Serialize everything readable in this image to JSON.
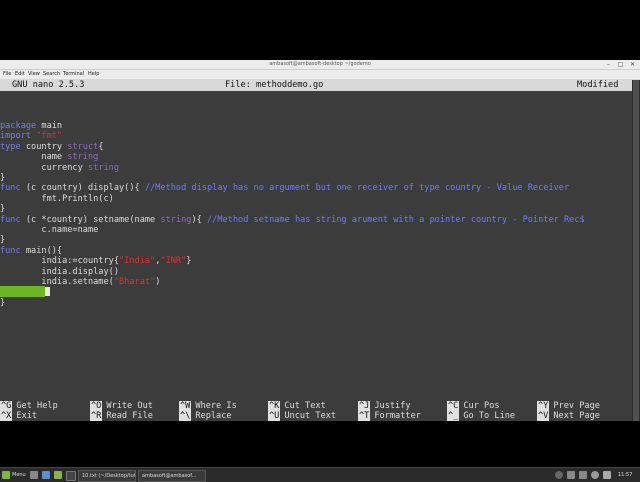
{
  "window": {
    "title": "ambasoft@ambasoft-desktop ~/godemo"
  },
  "menubar": [
    "File",
    "Edit",
    "View",
    "Search",
    "Terminal",
    "Help"
  ],
  "nano": {
    "version": "GNU nano 2.5.3",
    "file": "File: methoddemo.go",
    "status": "Modified"
  },
  "code": [
    [
      [
        "kw",
        "package"
      ],
      [
        "id",
        " main"
      ]
    ],
    [
      [
        "kw",
        "import"
      ],
      [
        "id",
        " "
      ],
      [
        "st",
        "\"fmt\""
      ]
    ],
    [
      [
        "kw",
        "type"
      ],
      [
        "id",
        " country "
      ],
      [
        "ty",
        "struct"
      ],
      [
        "id",
        "{"
      ]
    ],
    [
      [
        "id",
        "        name "
      ],
      [
        "ty",
        "string"
      ]
    ],
    [
      [
        "id",
        "        currency "
      ],
      [
        "ty",
        "string"
      ]
    ],
    [
      [
        "id",
        "}"
      ]
    ],
    [
      [
        "kw",
        "func"
      ],
      [
        "id",
        " (c country) display(){ "
      ],
      [
        "cm",
        "//Method display has no argument but one receiver of type country - Value Receiver"
      ]
    ],
    [
      [
        "id",
        "        fmt.Println(c)"
      ]
    ],
    [
      [
        "id",
        "}"
      ]
    ],
    [
      [
        "kw",
        "func"
      ],
      [
        "id",
        " (c *country) setname(name "
      ],
      [
        "ty",
        "string"
      ],
      [
        "id",
        "){ "
      ],
      [
        "cm",
        "//Method setname has string arument with a pointer country - Pointer Rec$"
      ]
    ],
    [
      [
        "id",
        "        c.name=name"
      ]
    ],
    [
      [
        "id",
        "}"
      ]
    ],
    [
      [
        "kw",
        "func"
      ],
      [
        "id",
        " main(){"
      ]
    ],
    [
      [
        "id",
        "        india:=country{"
      ],
      [
        "st",
        "\"India\""
      ],
      [
        "id",
        ","
      ],
      [
        "st",
        "\"INR\""
      ],
      [
        "id",
        "}"
      ]
    ],
    [
      [
        "id",
        "        india.display()"
      ]
    ],
    [
      [
        "id",
        "        india.setname("
      ],
      [
        "st",
        "\"Bharat\""
      ],
      [
        "id",
        ")"
      ]
    ],
    [
      [
        "id",
        ""
      ]
    ],
    [
      [
        "id",
        "}"
      ]
    ]
  ],
  "shortcuts": [
    {
      "key1": "^G",
      "label1": "Get Help",
      "key2": "^X",
      "label2": "Exit"
    },
    {
      "key1": "^O",
      "label1": "Write Out",
      "key2": "^R",
      "label2": "Read File"
    },
    {
      "key1": "^W",
      "label1": "Where Is",
      "key2": "^\\",
      "label2": "Replace"
    },
    {
      "key1": "^K",
      "label1": "Cut Text",
      "key2": "^U",
      "label2": "Uncut Text"
    },
    {
      "key1": "^J",
      "label1": "Justify",
      "key2": "^T",
      "label2": "Formatter"
    },
    {
      "key1": "^C",
      "label1": "Cur Pos",
      "key2": "^_",
      "label2": "Go To Line"
    },
    {
      "key1": "^Y",
      "label1": "Prev Page",
      "key2": "^V",
      "label2": "Next Page"
    }
  ],
  "taskbar": {
    "menu": "Menu",
    "tasks": [
      "10.txt (~/Desktop/tut...",
      "ambasoft@ambasof..."
    ],
    "clock": "11:57"
  },
  "colors": {
    "cursor_line": "#6cb523",
    "keyword": "#7a7ae8",
    "string": "#e03030",
    "comment": "#7777ff",
    "background": "#3c3c3c"
  }
}
